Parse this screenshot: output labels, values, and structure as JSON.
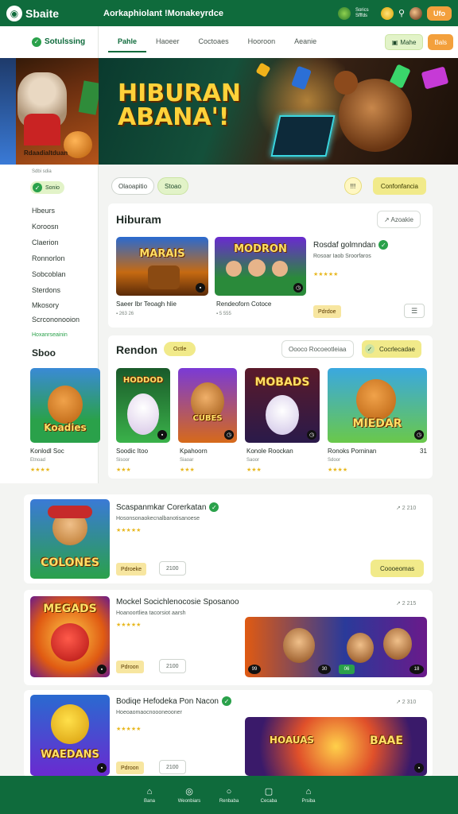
{
  "brand": {
    "logo_text": "Sbaite",
    "title": "Aorkaphiolant !Monakeyrdce"
  },
  "topbar": {
    "small_text": "Sorics Sfffds",
    "button_label": "Ufo"
  },
  "sidebar": {
    "header": "Sotulssing",
    "promo_caption": "Rdaadialtduan",
    "sub_caption": "Sdbi sdia",
    "chip_label": "Sonio",
    "items": [
      {
        "label": "Hbeurs",
        "active": false
      },
      {
        "label": "Koroosn",
        "active": false
      },
      {
        "label": "Claerion",
        "active": false
      },
      {
        "label": "Ronnorlon",
        "active": false
      },
      {
        "label": "Sobcoblan",
        "active": false
      },
      {
        "label": "Sterdons",
        "active": false
      },
      {
        "label": "Mkosory",
        "active": false
      },
      {
        "label": "Scrcononooion",
        "active": false
      },
      {
        "label": "Hoxanrseainin",
        "active": true
      }
    ],
    "section_label": "Sboo"
  },
  "tabs": [
    {
      "label": "Pahle",
      "active": true
    },
    {
      "label": "Haoeer",
      "active": false
    },
    {
      "label": "Coctoaes",
      "active": false
    },
    {
      "label": "Hooroon",
      "active": false
    },
    {
      "label": "Aeanie",
      "active": false
    }
  ],
  "header_buttons": {
    "green": "Mahe",
    "orange": "Bals"
  },
  "hero": {
    "title_line1": "HIBURAN",
    "title_line2": "ABANA'!"
  },
  "filters": {
    "pill1": "Olaoapitio",
    "pill2": "Stoao",
    "round_label": "!!!",
    "cta": "Confonfancia"
  },
  "section1": {
    "title": "Hiburam",
    "sort_label": "↗ Azoakie",
    "games": [
      {
        "thumb_text": "MARAIS",
        "title": "Saeer Ibr Teoagh hlie",
        "sub": "▪ 263 26"
      },
      {
        "thumb_text": "MODRON",
        "title": "Rendeoforn Cotoce",
        "sub": "▪ 5 555"
      }
    ],
    "featured_title": "Rosdaf golmndan",
    "featured_sub": "Rosoar Iaob Sroorfaros",
    "featured_stars": "★★★★★",
    "featured_tag": "Pdrdoe",
    "list_icon": "☰"
  },
  "section2": {
    "title": "Rendon",
    "pill": "Octle",
    "pill_outline": "Oooco Rocoeotleiaa",
    "cta": "Cocrlecadae",
    "cards": [
      {
        "thumb_text": "Koadies",
        "title": "Konlodl Soc",
        "sub": "Etnoad",
        "stars": "★★★★"
      },
      {
        "thumb_text": "HODDOD",
        "title": "Soodic Itoo",
        "sub": "Sisoor",
        "stars": "★★★"
      },
      {
        "thumb_text": "CUBES",
        "title": "Kpahoorn",
        "sub": "Siaoar",
        "stars": "★★★"
      },
      {
        "thumb_text": "MOBADS",
        "title": "Konole Roockan",
        "sub": "Saoor",
        "stars": "★★★"
      },
      {
        "thumb_text": "MIEDAR",
        "title": "Ronoks Porninan",
        "sub": "Sdoor",
        "stars": "★★★★"
      }
    ],
    "edge_text": "31"
  },
  "list_games": [
    {
      "thumb_text": "COLONES",
      "title": "Scaspanmkar Corerkatan",
      "sub": "Hosonsonaokecnalbanotisanoese",
      "stars": "★★★★★",
      "meta": "↗ 2 210",
      "tag": "Pdroeke",
      "outline": "2100",
      "cta": "Coooeomas"
    },
    {
      "thumb_text": "MEGADS",
      "title": "Mockel Socichlenocosie Sposanoo",
      "sub": "Hoanoortliea tacorsiot aarsh",
      "stars": "★★★★★",
      "meta": "↗ 2 215",
      "tag": "Pdroon",
      "outline": "2100",
      "banner_badges": [
        "99",
        "30",
        "06",
        "18"
      ]
    },
    {
      "thumb_text": "WAEDANS",
      "title": "Bodiqe Hefodeka Pon Nacon",
      "sub": "Hoeoaomaocnoooneooner",
      "stars": "★★★★★",
      "meta": "↗ 2 310",
      "tag": "Pdroon",
      "outline": "2100",
      "banner_text_l": "HOAUAS",
      "banner_text_r": "BAAE"
    }
  ],
  "bottom_nav": [
    {
      "icon": "home-icon",
      "glyph": "⌂",
      "label": "Bana"
    },
    {
      "icon": "games-icon",
      "glyph": "◎",
      "label": "Weonbiars"
    },
    {
      "icon": "chat-icon",
      "glyph": "○",
      "label": "Renbaba"
    },
    {
      "icon": "wallet-icon",
      "glyph": "▢",
      "label": "Cecaba"
    },
    {
      "icon": "profile-icon",
      "glyph": "⌂",
      "label": "Prsiba"
    }
  ]
}
